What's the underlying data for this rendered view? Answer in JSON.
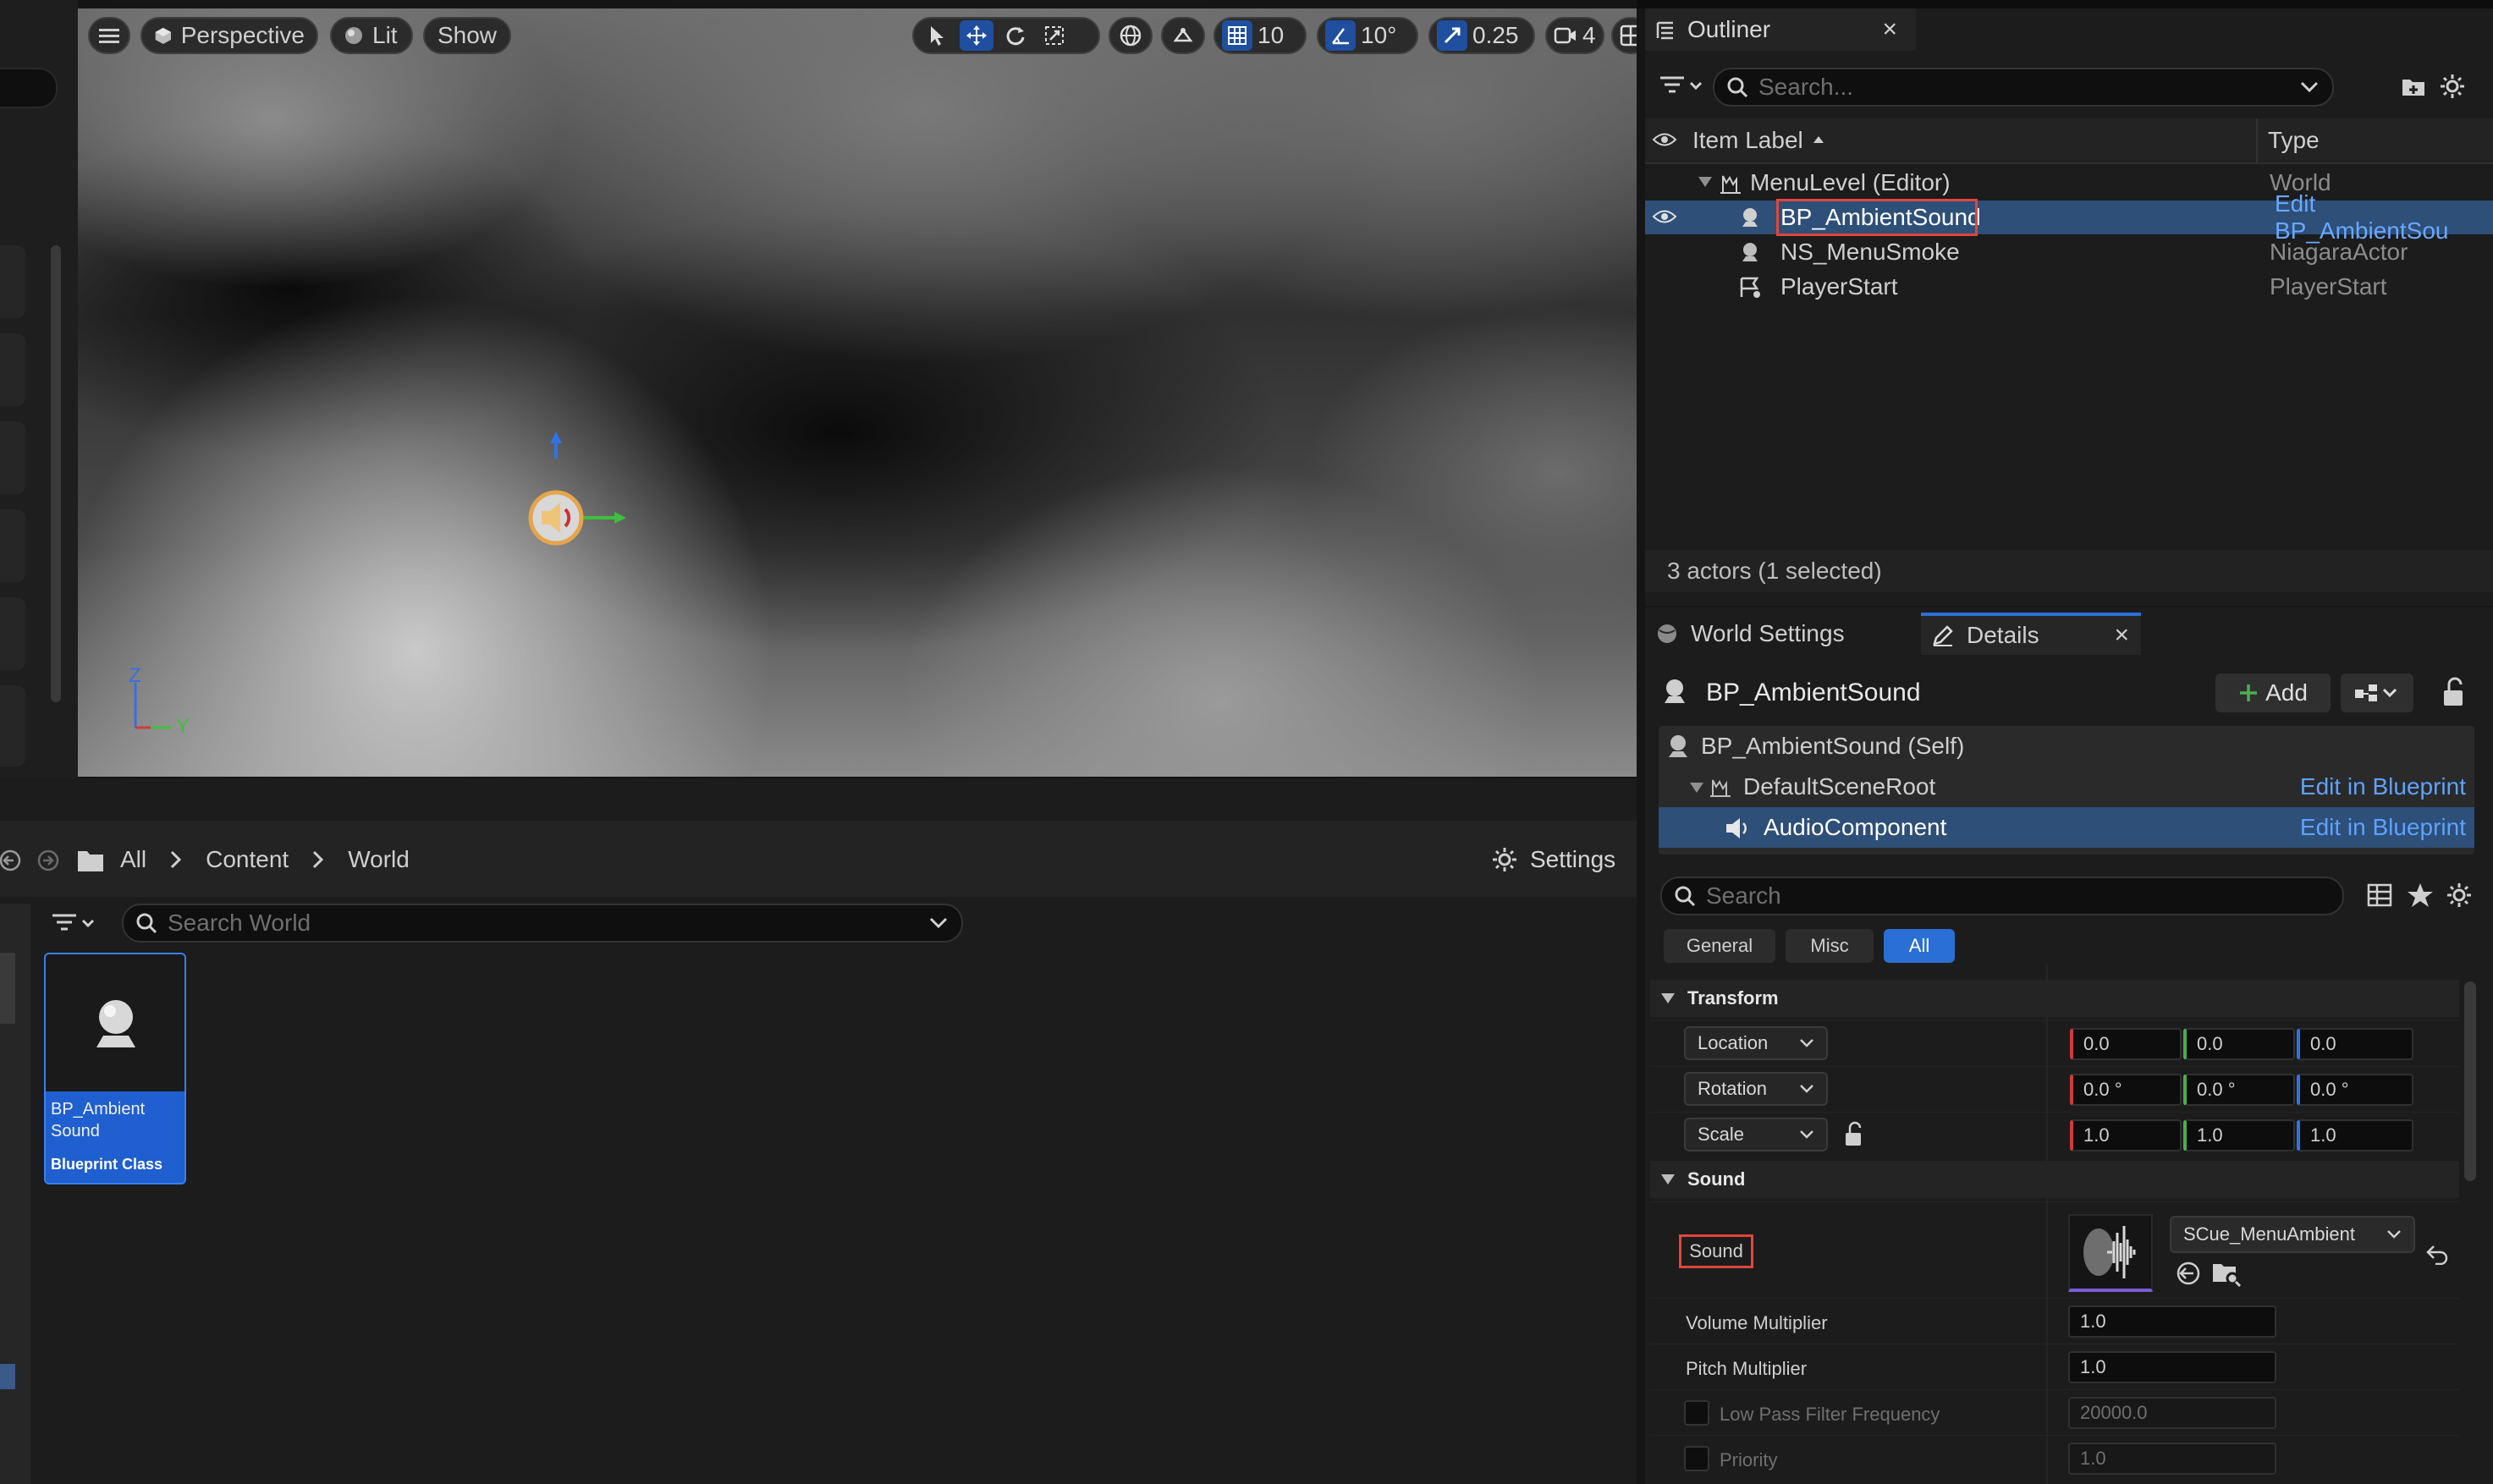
{
  "viewport": {
    "perspective_label": "Perspective",
    "lit_label": "Lit",
    "show_label": "Show",
    "grid_snap": "10",
    "rotation_snap": "10°",
    "scale_snap": "0.25",
    "camera_speed": "4",
    "axis_z": "Z",
    "axis_y": "Y"
  },
  "outliner": {
    "tab_title": "Outliner",
    "search_placeholder": "Search...",
    "col_label": "Item Label",
    "col_type": "Type",
    "rows": [
      {
        "label": "MenuLevel (Editor)",
        "type": "World"
      },
      {
        "label": "BP_AmbientSound",
        "type": "Edit BP_AmbientSou"
      },
      {
        "label": "NS_MenuSmoke",
        "type": "NiagaraActor"
      },
      {
        "label": "PlayerStart",
        "type": "PlayerStart"
      }
    ],
    "status": "3 actors (1 selected)"
  },
  "details": {
    "tab_world_settings": "World Settings",
    "tab_details": "Details",
    "actor_name": "BP_AmbientSound",
    "add_label": "Add",
    "components": [
      {
        "label": "BP_AmbientSound (Self)",
        "edit": ""
      },
      {
        "label": "DefaultSceneRoot",
        "edit": "Edit in Blueprint"
      },
      {
        "label": "AudioComponent",
        "edit": "Edit in Blueprint"
      }
    ],
    "search_placeholder": "Search",
    "filters": {
      "general": "General",
      "misc": "Misc",
      "all": "All"
    },
    "transform": {
      "section": "Transform",
      "location": {
        "label": "Location",
        "x": "0.0",
        "y": "0.0",
        "z": "0.0"
      },
      "rotation": {
        "label": "Rotation",
        "x": "0.0 °",
        "y": "0.0 °",
        "z": "0.0 °"
      },
      "scale": {
        "label": "Scale",
        "x": "1.0",
        "y": "1.0",
        "z": "1.0"
      }
    },
    "sound": {
      "section": "Sound",
      "sound_label": "Sound",
      "sound_asset": "SCue_MenuAmbient",
      "volume_label": "Volume Multiplier",
      "volume_value": "1.0",
      "pitch_label": "Pitch Multiplier",
      "pitch_value": "1.0",
      "lowpass_label": "Low Pass Filter Frequency",
      "lowpass_value": "20000.0",
      "priority_label": "Priority",
      "priority_value": "1.0"
    }
  },
  "content_browser": {
    "breadcrumb": [
      "All",
      "Content",
      "World"
    ],
    "settings_label": "Settings",
    "search_placeholder": "Search World",
    "asset": {
      "name_line1": "BP_Ambient",
      "name_line2": "Sound",
      "type": "Blueprint Class"
    }
  },
  "colors": {
    "accent": "#2a6fd6",
    "selection": "#2d4f78",
    "link": "#5ea2ff",
    "highlight_box": "#e0463b"
  }
}
